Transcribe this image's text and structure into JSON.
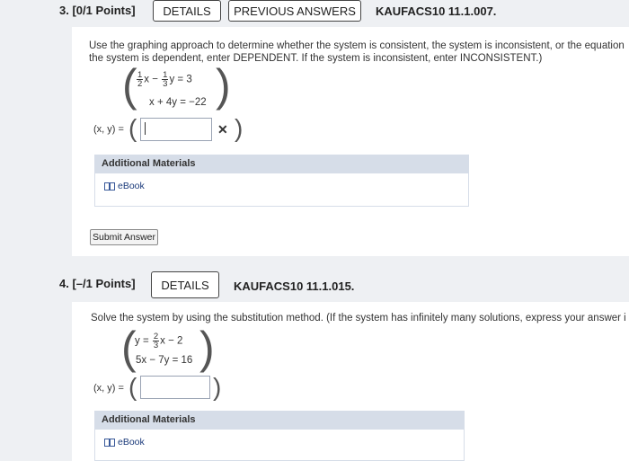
{
  "q3": {
    "header": "3.  [0/1 Points]",
    "details_label": "DETAILS",
    "prev_answers_label": "PREVIOUS ANSWERS",
    "code": "KAUFACS10 11.1.007.",
    "prompt_line1": "Use the graphing approach to determine whether the system is consistent, the system is inconsistent, or the equation",
    "prompt_line2": "the system is dependent, enter DEPENDENT. If the system is inconsistent, enter INCONSISTENT.)",
    "eq1": {
      "f1_num": "1",
      "f1_den": "2",
      "mid": "x −",
      "f2_num": "1",
      "f2_den": "3",
      "rhs": "y  =  3"
    },
    "eq2": "x + 4y  =  −22",
    "answer_label": "(x, y) =",
    "answer_value": "",
    "feedback_icon": "incorrect-x-icon",
    "additional_materials": "Additional Materials",
    "ebook_label": "eBook",
    "submit_label": "Submit Answer"
  },
  "q4": {
    "header": "4.  [–/1 Points]",
    "details_label": "DETAILS",
    "code": "KAUFACS10 11.1.015.",
    "prompt_line1": "Solve the system by using the substitution method. (If the system has infinitely many solutions, express your answer i",
    "eq1": {
      "lhs": "y =",
      "f_num": "2",
      "f_den": "3",
      "rhs": "x − 2"
    },
    "eq2": "5x − 7y  =  16",
    "answer_label": "(x, y) =",
    "answer_value": "",
    "additional_materials": "Additional Materials",
    "ebook_label": "eBook"
  },
  "colors": {
    "accent_header": "#d6dde8",
    "page_bg": "#eef0f3",
    "link": "#1a3a7a"
  }
}
